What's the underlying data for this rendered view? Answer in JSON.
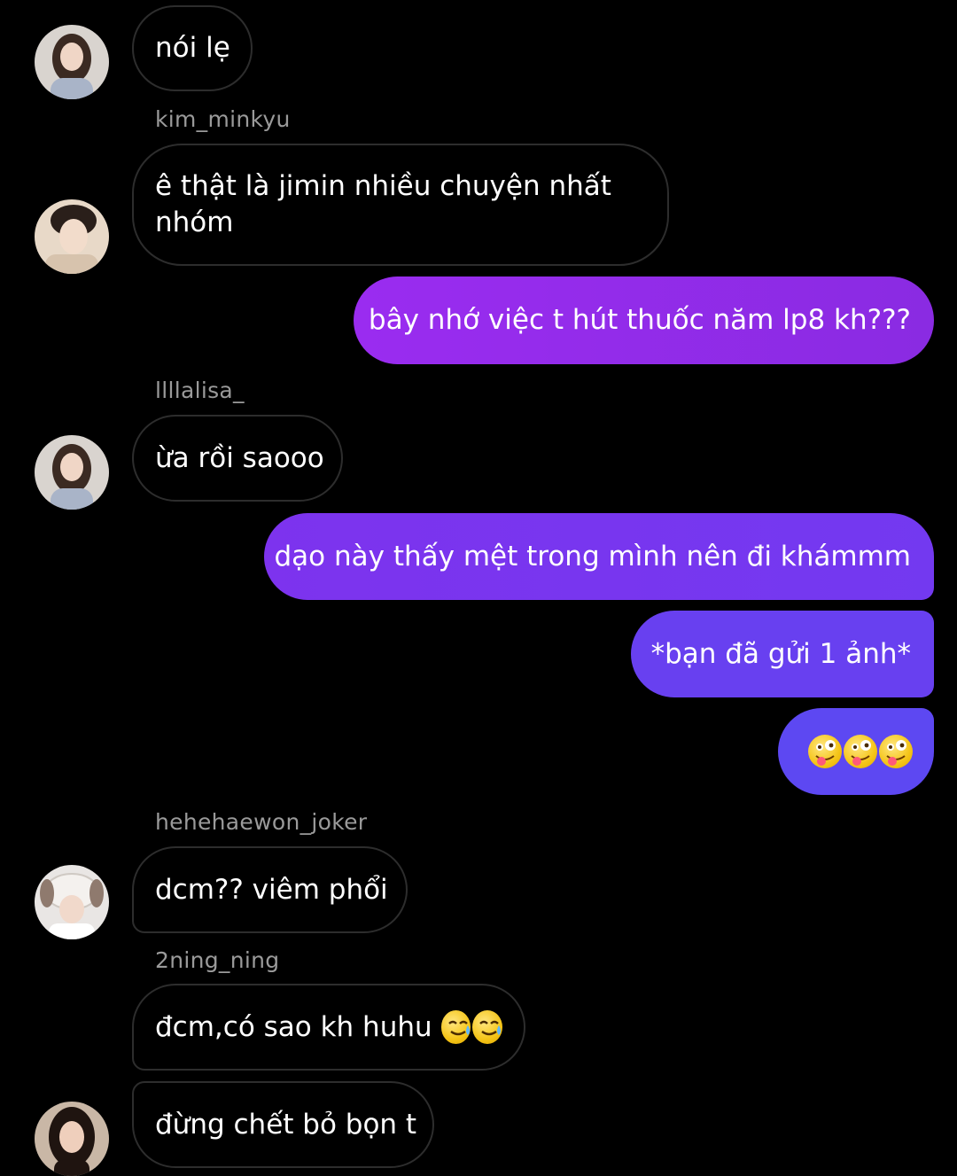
{
  "messages": [
    {
      "text": "nói lẹ"
    },
    {
      "username": "kim_minkyu",
      "text": "ê thật là jimin nhiều chuyện nhất nhóm"
    },
    {
      "text": "bây nhớ việc t hút thuốc năm lp8 kh???"
    },
    {
      "username": "llllalisa_",
      "text": "ừa rồi saooo"
    },
    {
      "text": "dạo này thấy mệt trong mình nên đi khámmm"
    },
    {
      "text": "*bạn đã gửi 1 ảnh*"
    },
    {
      "emoji": "zany-face-emoji",
      "count": 3
    },
    {
      "username": "hehehaewon_joker",
      "text": "dcm?? viêm phổi"
    },
    {
      "username": "2ning_ning",
      "text": "đcm,có sao kh huhu"
    },
    {
      "text": "đừng chết bỏ bọn t"
    }
  ],
  "colors": {
    "background": "#000000",
    "incoming_border": "#2d2d2d",
    "username": "#9a9a9a",
    "outgoing_gradient": [
      "#8a2be2",
      "#6f3cf0",
      "#5a4cf2"
    ]
  }
}
